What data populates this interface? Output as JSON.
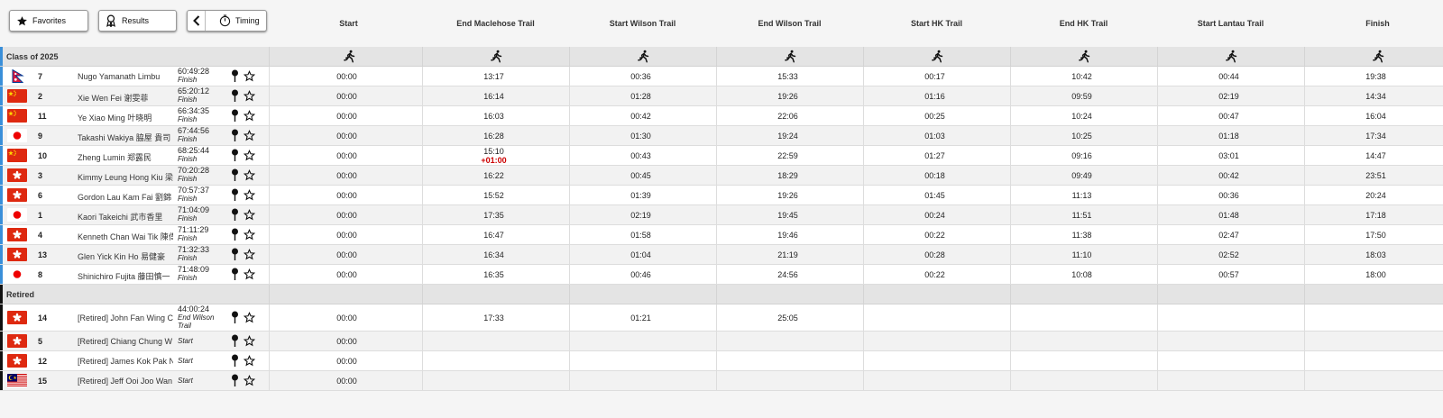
{
  "toolbar": {
    "favorites_label": "Favorites",
    "results_label": "Results",
    "timing_label": "Timing"
  },
  "columns": [
    "Start",
    "End Maclehose Trail",
    "Start Wilson Trail",
    "End Wilson Trail",
    "Start HK Trail",
    "End HK Trail",
    "Start Lantau Trail",
    "Finish"
  ],
  "sections": [
    {
      "title": "Class of 2025",
      "stripe": "#3a8fd9",
      "rows": [
        {
          "flag": "nepal",
          "bib": "7",
          "name": "Nugo Yamanath Limbu",
          "total": "60:49:28",
          "status": "Finish",
          "splits": [
            "00:00",
            "13:17",
            "00:36",
            "15:33",
            "00:17",
            "10:42",
            "00:44",
            "19:38"
          ],
          "penalty": ""
        },
        {
          "flag": "china",
          "bib": "2",
          "name": "Xie Wen Fei 谢雯菲",
          "total": "65:20:12",
          "status": "Finish",
          "splits": [
            "00:00",
            "16:14",
            "01:28",
            "19:26",
            "01:16",
            "09:59",
            "02:19",
            "14:34"
          ],
          "penalty": ""
        },
        {
          "flag": "china",
          "bib": "11",
          "name": "Ye Xiao Ming 叶晓明",
          "total": "66:34:35",
          "status": "Finish",
          "splits": [
            "00:00",
            "16:03",
            "00:42",
            "22:06",
            "00:25",
            "10:24",
            "00:47",
            "16:04"
          ],
          "penalty": ""
        },
        {
          "flag": "japan",
          "bib": "9",
          "name": "Takashi Wakiya 脇屋 貴司",
          "total": "67:44:56",
          "status": "Finish",
          "splits": [
            "00:00",
            "16:28",
            "01:30",
            "19:24",
            "01:03",
            "10:25",
            "01:18",
            "17:34"
          ],
          "penalty": ""
        },
        {
          "flag": "china",
          "bib": "10",
          "name": "Zheng Lumin 郑露民",
          "total": "68:25:44",
          "status": "Finish",
          "splits": [
            "00:00",
            "15:10",
            "00:43",
            "22:59",
            "01:27",
            "09:16",
            "03:01",
            "14:47"
          ],
          "penalty": "+01:00"
        },
        {
          "flag": "hk",
          "bib": "3",
          "name": "Kimmy Leung Hong Kiu 梁",
          "total": "70:20:28",
          "status": "Finish",
          "splits": [
            "00:00",
            "16:22",
            "00:45",
            "18:29",
            "00:18",
            "09:49",
            "00:42",
            "23:51"
          ],
          "penalty": ""
        },
        {
          "flag": "hk",
          "bib": "6",
          "name": "Gordon Lau Kam Fai 劉錦",
          "total": "70:57:37",
          "status": "Finish",
          "splits": [
            "00:00",
            "15:52",
            "01:39",
            "19:26",
            "01:45",
            "11:13",
            "00:36",
            "20:24"
          ],
          "penalty": ""
        },
        {
          "flag": "japan",
          "bib": "1",
          "name": "Kaori Takeichi 武市香里",
          "total": "71:04:09",
          "status": "Finish",
          "splits": [
            "00:00",
            "17:35",
            "02:19",
            "19:45",
            "00:24",
            "11:51",
            "01:48",
            "17:18"
          ],
          "penalty": ""
        },
        {
          "flag": "hk",
          "bib": "4",
          "name": "Kenneth Chan Wai Tik 陳偉",
          "total": "71:11:29",
          "status": "Finish",
          "splits": [
            "00:00",
            "16:47",
            "01:58",
            "19:46",
            "00:22",
            "11:38",
            "02:47",
            "17:50"
          ],
          "penalty": ""
        },
        {
          "flag": "hk",
          "bib": "13",
          "name": "Glen Yick Kin Ho 易健豪",
          "total": "71:32:33",
          "status": "Finish",
          "splits": [
            "00:00",
            "16:34",
            "01:04",
            "21:19",
            "00:28",
            "11:10",
            "02:52",
            "18:03"
          ],
          "penalty": ""
        },
        {
          "flag": "japan",
          "bib": "8",
          "name": "Shinichiro Fujita 藤田慎一",
          "total": "71:48:09",
          "status": "Finish",
          "splits": [
            "00:00",
            "16:35",
            "00:46",
            "24:56",
            "00:22",
            "10:08",
            "00:57",
            "18:00"
          ],
          "penalty": ""
        }
      ]
    },
    {
      "title": "Retired",
      "stripe": "#111111",
      "rows": [
        {
          "flag": "hk",
          "bib": "14",
          "name": "[Retired] John Fan Wing C",
          "total": "44:00:24",
          "status": "End Wilson Trail",
          "splits": [
            "00:00",
            "17:33",
            "01:21",
            "25:05",
            "",
            "",
            "",
            ""
          ],
          "penalty": ""
        },
        {
          "flag": "hk",
          "bib": "5",
          "name": "[Retired] Chiang Chung W",
          "total": "",
          "status": "Start",
          "splits": [
            "00:00",
            "",
            "",
            "",
            "",
            "",
            "",
            ""
          ],
          "penalty": ""
        },
        {
          "flag": "hk",
          "bib": "12",
          "name": "[Retired] James Kok Pak N",
          "total": "",
          "status": "Start",
          "splits": [
            "00:00",
            "",
            "",
            "",
            "",
            "",
            "",
            ""
          ],
          "penalty": ""
        },
        {
          "flag": "malaysia",
          "bib": "15",
          "name": "[Retired] Jeff Ooi Joo Wan",
          "total": "",
          "status": "Start",
          "splits": [
            "00:00",
            "",
            "",
            "",
            "",
            "",
            "",
            ""
          ],
          "penalty": ""
        }
      ]
    }
  ],
  "colors": {
    "stripe_class": "#3a8fd9",
    "stripe_retired": "#111111",
    "penalty": "#cc0000"
  }
}
